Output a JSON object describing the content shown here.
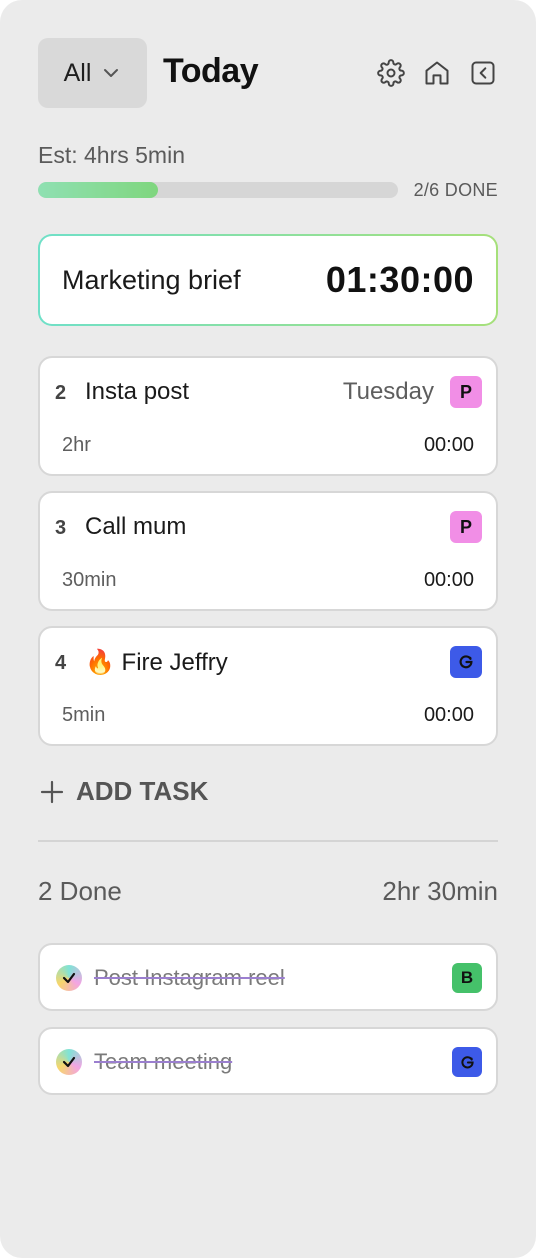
{
  "header": {
    "filter_label": "All",
    "title": "Today",
    "icons": [
      "gear-icon",
      "home-icon",
      "collapse-icon"
    ]
  },
  "estimate": {
    "label": "Est: 4hrs 5min",
    "progress_fraction": 0.333,
    "progress_label": "2/6 DONE"
  },
  "current_task": {
    "title": "Marketing brief",
    "timer": "01:30:00"
  },
  "tasks": [
    {
      "number": "2",
      "title": "Insta post",
      "day": "Tuesday",
      "badge": "P",
      "duration": "2hr",
      "time": "00:00"
    },
    {
      "number": "3",
      "title": "Call mum",
      "day": "",
      "badge": "P",
      "duration": "30min",
      "time": "00:00"
    },
    {
      "number": "4",
      "title": "🔥 Fire Jeffry",
      "day": "",
      "badge": "G",
      "duration": "5min",
      "time": "00:00"
    }
  ],
  "add_task_label": "ADD TASK",
  "done_section": {
    "count_label": "2 Done",
    "total_label": "2hr 30min",
    "items": [
      {
        "title": "Post Instagram reel",
        "badge": "B"
      },
      {
        "title": "Team meeting",
        "badge": "G"
      }
    ]
  },
  "colors": {
    "badge_p": "#f18ee6",
    "badge_g": "#3d5ae8",
    "badge_b": "#45c16a",
    "progress": "#8fe0b2"
  }
}
